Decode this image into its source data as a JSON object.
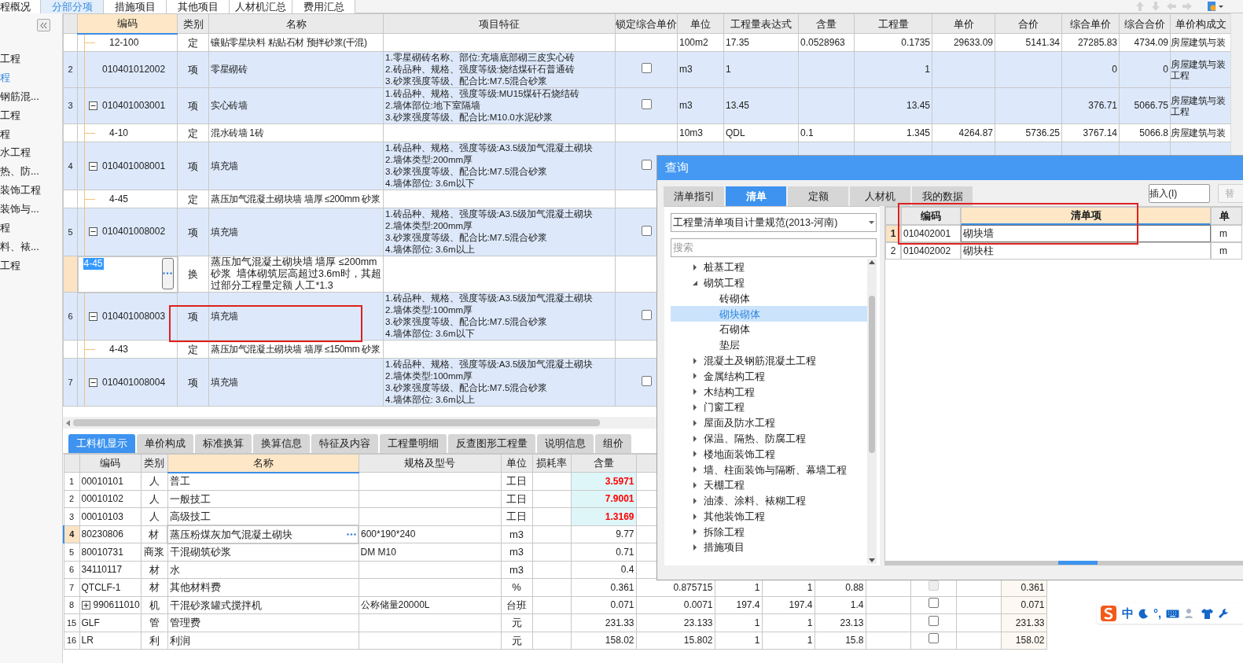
{
  "top_tabs": [
    {
      "label": "程概况",
      "selected": false
    },
    {
      "label": "分部分项",
      "selected": true
    },
    {
      "label": "措施项目",
      "selected": false
    },
    {
      "label": "其他项目",
      "selected": false
    },
    {
      "label": "人材机汇总",
      "selected": false
    },
    {
      "label": "费用汇总",
      "selected": false
    }
  ],
  "sidebar": {
    "items": [
      {
        "label": "工程",
        "selected": false
      },
      {
        "label": "程",
        "selected": true
      },
      {
        "label": "钢筋混...",
        "selected": false
      },
      {
        "label": "工程",
        "selected": false
      },
      {
        "label": "程",
        "selected": false
      },
      {
        "label": "水工程",
        "selected": false
      },
      {
        "label": "热、防...",
        "selected": false
      },
      {
        "label": "装饰工程",
        "selected": false
      },
      {
        "label": "装饰与...",
        "selected": false
      },
      {
        "label": "程",
        "selected": false
      },
      {
        "label": "料、裱...",
        "selected": false
      },
      {
        "label": "工程",
        "selected": false
      }
    ]
  },
  "main_table": {
    "columns": [
      "编码",
      "类别",
      "名称",
      "项目特征",
      "锁定综合单价",
      "单位",
      "工程量表达式",
      "含量",
      "工程量",
      "单价",
      "合价",
      "综合单价",
      "综合合价",
      "单价构成文"
    ],
    "rows": [
      {
        "kind": "sub",
        "code": "12-100",
        "type": "定",
        "name": "镶贴零星块料 粘贴石材 预拌砂浆(干混)",
        "cells": [
          "100m2",
          "17.35",
          "0.0528963",
          "0.1735",
          "29633.09",
          "5141.34",
          "27285.83",
          "4734.09",
          "房屋建筑与装"
        ]
      },
      {
        "kind": "item",
        "num": "2",
        "code": "010401012002",
        "type": "项",
        "name": "零星砌砖",
        "features": "1.零星砌砖名称、部位:充墙底部砌三皮实心砖\n2.砖品种、规格、强度等级:烧结煤矸石普通砖\n3.砂浆强度等级、配合比:M7.5混合砂浆",
        "locked": false,
        "cells": [
          "m3",
          "1",
          "",
          "1",
          "",
          "",
          "0",
          "0",
          "房屋建筑与装",
          "工程"
        ]
      },
      {
        "kind": "item",
        "num": "3",
        "code": "010401003001",
        "expanded": true,
        "type": "项",
        "name": "实心砖墙",
        "features": "1.砖品种、规格、强度等级:MU15煤矸石烧结砖\n2.墙体部位:地下室隔墙\n3.砂浆强度等级、配合比:M10.0水泥砂浆",
        "locked": false,
        "cells": [
          "m3",
          "13.45",
          "",
          "13.45",
          "",
          "",
          "376.71",
          "5066.75",
          "房屋建筑与装",
          "工程"
        ]
      },
      {
        "kind": "sub",
        "code": "4-10",
        "type": "定",
        "name": "混水砖墙 1砖",
        "cells": [
          "10m3",
          "QDL",
          "0.1",
          "1.345",
          "4264.87",
          "5736.25",
          "3767.14",
          "5066.8",
          "房屋建筑与装"
        ]
      },
      {
        "kind": "item",
        "num": "4",
        "code": "010401008001",
        "expanded": true,
        "type": "项",
        "name": "填充墙",
        "features": "1.砖品种、规格、强度等级:A3.5级加气混凝土砌块\n2.墙体类型:200mm厚\n3.砂浆强度等级、配合比:M7.5混合砂浆\n4.墙体部位: 3.6m以下",
        "locked": false
      },
      {
        "kind": "sub",
        "code": "4-45",
        "type": "定",
        "name": "蒸压加气混凝土砌块墙 墙厚 ≤200mm 砂浆"
      },
      {
        "kind": "item",
        "num": "5",
        "code": "010401008002",
        "expanded": true,
        "type": "项",
        "name": "填充墙",
        "features": "1.砖品种、规格、强度等级:A3.5级加气混凝土砌块\n2.墙体类型:200mm厚\n3.砂浆强度等级、配合比:M7.5混合砂浆\n4.墙体部位: 3.6m以上",
        "locked": false
      },
      {
        "kind": "editing",
        "code": "4-45",
        "type": "换",
        "name": "蒸压加气混凝土砌块墙 墙厚 ≤200mm 砂浆  墙体砌筑层高超过3.6m时，其超过部分工程量定额 人工*1.3"
      },
      {
        "kind": "item",
        "num": "6",
        "code": "010401008003",
        "expanded": true,
        "type": "项",
        "name": "填充墙",
        "features": "1.砖品种、规格、强度等级:A3.5级加气混凝土砌块\n2.墙体类型:100mm厚\n3.砂浆强度等级、配合比:M7.5混合砂浆\n4.墙体部位: 3.6m以下",
        "locked": false
      },
      {
        "kind": "sub",
        "code": "4-43",
        "type": "定",
        "name": "蒸压加气混凝土砌块墙 墙厚 ≤150mm 砂浆"
      },
      {
        "kind": "item",
        "num": "7",
        "code": "010401008004",
        "expanded": true,
        "type": "项",
        "name": "填充墙",
        "features": "1.砖品种、规格、强度等级:A3.5级加气混凝土砌块\n2.墙体类型:100mm厚\n3.砂浆强度等级、配合比:M7.5混合砂浆\n4.墙体部位: 3.6m以上",
        "locked": false
      }
    ]
  },
  "bottom_tabs": [
    {
      "label": "工料机显示",
      "selected": true
    },
    {
      "label": "单价构成",
      "selected": false
    },
    {
      "label": "标准换算",
      "selected": false
    },
    {
      "label": "换算信息",
      "selected": false
    },
    {
      "label": "特征及内容",
      "selected": false
    },
    {
      "label": "工程量明细",
      "selected": false
    },
    {
      "label": "反查图形工程量",
      "selected": false
    },
    {
      "label": "说明信息",
      "selected": false
    },
    {
      "label": "组价",
      "selected": false
    }
  ],
  "bottom_table": {
    "columns": [
      "编码",
      "类别",
      "名称",
      "规格及型号",
      "单位",
      "损耗率",
      "含量"
    ],
    "rows": [
      {
        "num": "1",
        "code": "00010101",
        "type": "人",
        "name": "普工",
        "spec": "",
        "unit": "工日",
        "amount": "3.5971",
        "modified": true,
        "selected": false
      },
      {
        "num": "2",
        "code": "00010102",
        "type": "人",
        "name": "一般技工",
        "spec": "",
        "unit": "工日",
        "amount": "7.9001",
        "modified": true,
        "selected": false
      },
      {
        "num": "3",
        "code": "00010103",
        "type": "人",
        "name": "高级技工",
        "spec": "",
        "unit": "工日",
        "amount": "1.3169",
        "modified": true,
        "selected": false
      },
      {
        "num": "4",
        "code": "80230806",
        "type": "材",
        "name": "蒸压粉煤灰加气混凝土砌块",
        "spec": "600*190*240",
        "unit": "m3",
        "amount": "9.77",
        "modified": false,
        "selected": true
      },
      {
        "num": "5",
        "code": "80010731",
        "type": "商浆",
        "name": "干混砌筑砂浆",
        "spec": "DM M10",
        "unit": "m3",
        "amount": "0.71",
        "modified": false,
        "selected": false
      },
      {
        "num": "6",
        "code": "34110117",
        "type": "材",
        "name": "水",
        "spec": "",
        "unit": "m3",
        "amount": "0.4",
        "modified": false,
        "selected": false
      },
      {
        "num": "7",
        "code": "QTCLF-1",
        "type": "材",
        "name": "其他材料费",
        "spec": "",
        "unit": "%",
        "amount": "0.361",
        "modified": false,
        "selected": false,
        "extra": [
          "0.875715",
          "1",
          "1",
          "0.88"
        ],
        "check": {
          "checked": false,
          "disabled": true
        },
        "last": "0.361"
      },
      {
        "num": "8",
        "code": "990611010",
        "expanded": false,
        "type": "机",
        "name": "干混砂浆罐式搅拌机",
        "spec": "公称储量20000L",
        "unit": "台班",
        "amount": "0.071",
        "modified": false,
        "selected": false,
        "extra": [
          "0.0071",
          "197.4",
          "197.4",
          "1.4"
        ],
        "check": {
          "checked": false,
          "disabled": false
        },
        "last": "0.071"
      },
      {
        "num": "15",
        "code": "GLF",
        "type": "管",
        "name": "管理费",
        "spec": "",
        "unit": "元",
        "amount": "231.33",
        "modified": false,
        "selected": false,
        "extra": [
          "23.133",
          "1",
          "1",
          "23.13"
        ],
        "check": {
          "checked": false,
          "disabled": false
        },
        "last": "231.33"
      },
      {
        "num": "16",
        "code": "LR",
        "type": "利",
        "name": "利润",
        "spec": "",
        "unit": "元",
        "amount": "158.02",
        "modified": false,
        "selected": false,
        "extra": [
          "15.802",
          "1",
          "1",
          "15.8"
        ],
        "check": {
          "checked": false,
          "disabled": false
        },
        "last": "158.02"
      }
    ]
  },
  "dialog": {
    "title": "查询",
    "tabs": [
      {
        "label": "清单指引",
        "selected": false
      },
      {
        "label": "清单",
        "selected": true
      },
      {
        "label": "定额",
        "selected": false
      },
      {
        "label": "人材机",
        "selected": false
      },
      {
        "label": "我的数据",
        "selected": false
      }
    ],
    "buttons": [
      {
        "label": "插入(I)",
        "disabled": false
      },
      {
        "label": "替",
        "disabled": true
      }
    ],
    "standard": "工程量清单项目计量规范(2013-河南)",
    "search": {
      "placeholder": "搜索"
    },
    "tree": [
      {
        "label": "桩基工程",
        "expanded": false,
        "selected": false
      },
      {
        "label": "砌筑工程",
        "expanded": true,
        "selected": false,
        "children": [
          {
            "label": "砖砌体",
            "selected": false
          },
          {
            "label": "砌块砌体",
            "selected": true
          },
          {
            "label": "石砌体",
            "selected": false
          },
          {
            "label": "垫层",
            "selected": false
          }
        ]
      },
      {
        "label": "混凝土及钢筋混凝土工程",
        "expanded": false,
        "selected": false
      },
      {
        "label": "金属结构工程",
        "expanded": false,
        "selected": false
      },
      {
        "label": "木结构工程",
        "expanded": false,
        "selected": false
      },
      {
        "label": "门窗工程",
        "expanded": false,
        "selected": false
      },
      {
        "label": "屋面及防水工程",
        "expanded": false,
        "selected": false
      },
      {
        "label": "保温、隔热、防腐工程",
        "expanded": false,
        "selected": false
      },
      {
        "label": "楼地面装饰工程",
        "expanded": false,
        "selected": false
      },
      {
        "label": "墙、柱面装饰与隔断、幕墙工程",
        "expanded": false,
        "selected": false
      },
      {
        "label": "天棚工程",
        "expanded": false,
        "selected": false
      },
      {
        "label": "油漆、涂料、裱糊工程",
        "expanded": false,
        "selected": false
      },
      {
        "label": "其他装饰工程",
        "expanded": false,
        "selected": false
      },
      {
        "label": "拆除工程",
        "expanded": false,
        "selected": false
      },
      {
        "label": "措施项目",
        "expanded": false,
        "selected": false
      }
    ],
    "result_columns": [
      "编码",
      "清单项",
      "单"
    ],
    "results": [
      {
        "num": "1",
        "code": "010402001",
        "name": "砌块墙",
        "unit": "m",
        "selected": true
      },
      {
        "num": "2",
        "code": "010402002",
        "name": "砌块柱",
        "unit": "m",
        "selected": false
      }
    ]
  },
  "ime": {
    "labels": [
      "中",
      "°,"
    ]
  }
}
